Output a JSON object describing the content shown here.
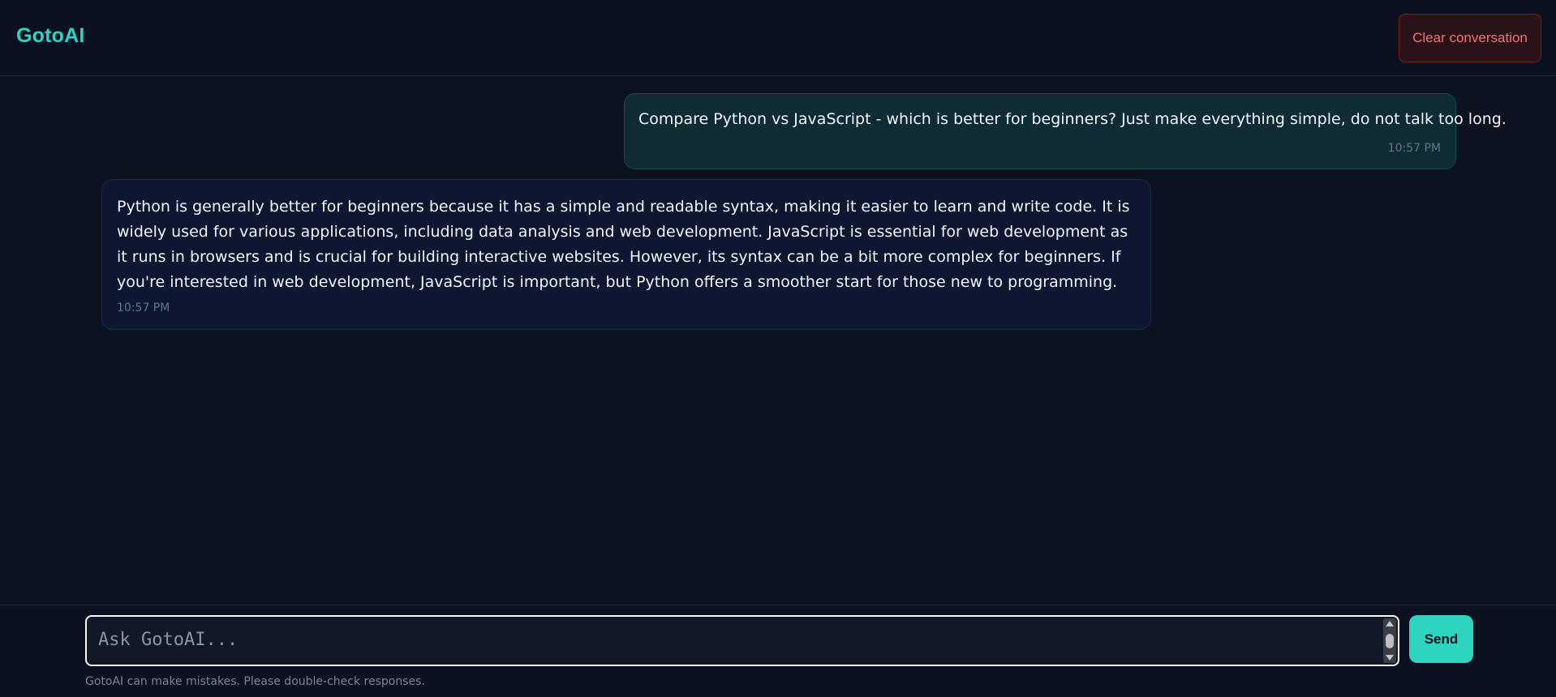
{
  "app": {
    "brand": "GotoAI"
  },
  "header": {
    "clear_label": "Clear conversation"
  },
  "messages": [
    {
      "role": "user",
      "text": "Compare Python vs JavaScript - which is better for beginners? Just make everything simple, do not talk too long.",
      "time": "10:57 PM"
    },
    {
      "role": "assistant",
      "text": "Python is generally better for beginners because it has a simple and readable syntax, making it easier to learn and write code. It is widely used for various applications, including data analysis and web development. JavaScript is essential for web development as it runs in browsers and is crucial for building interactive websites. However, its syntax can be a bit more complex for beginners. If you're interested in web development, JavaScript is important, but Python offers a smoother start for those new to programming.",
      "time": "10:57 PM"
    }
  ],
  "composer": {
    "placeholder": "Ask GotoAI...",
    "value": "",
    "send_label": "Send",
    "disclaimer": "GotoAI can make mistakes. Please double-check responses."
  },
  "colors": {
    "accent": "#2dd4bf",
    "danger": "#f87171",
    "background": "#0c1220"
  }
}
